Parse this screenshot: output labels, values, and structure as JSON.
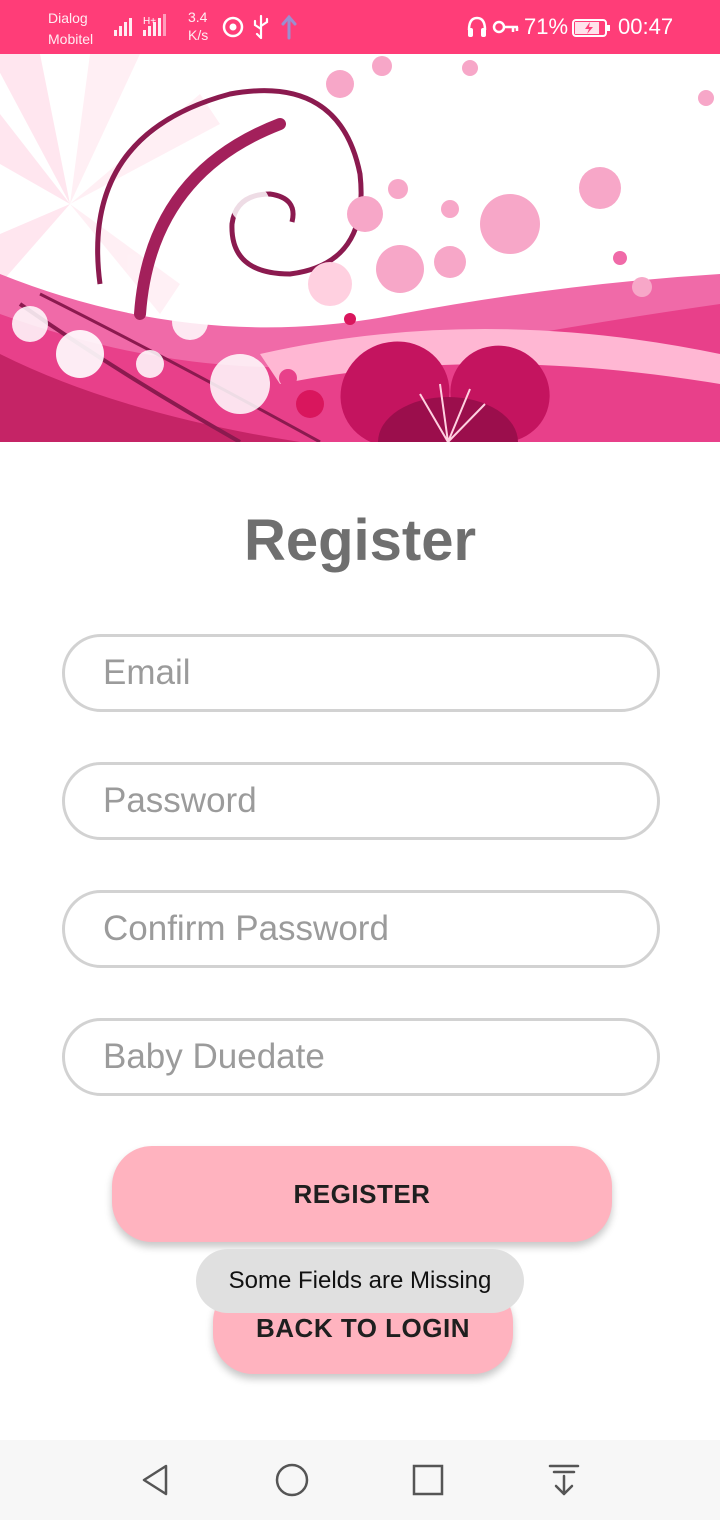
{
  "status_bar": {
    "carrier_line1": "Dialog",
    "carrier_line2": "Mobitel",
    "speed_value": "3.4",
    "speed_unit": "K/s",
    "battery_percent": "71%",
    "time": "00:47",
    "background_color": "#ff3d78",
    "icons": [
      "signal-icon",
      "signal-hplus-icon",
      "music-icon",
      "usb-icon",
      "upload-icon",
      "headphones-icon",
      "key-icon",
      "battery-charging-icon"
    ]
  },
  "hero": {
    "image_description_icon": "pink-swirl-flower-illustration"
  },
  "page": {
    "title": "Register"
  },
  "form": {
    "email_placeholder": "Email",
    "password_placeholder": "Password",
    "confirm_password_placeholder": "Confirm Password",
    "baby_duedate_placeholder": "Baby Duedate"
  },
  "buttons": {
    "register_label": "REGISTER",
    "back_to_login_label": "BACK TO LOGIN",
    "button_color": "#ffb3bf"
  },
  "toast": {
    "message": "Some Fields are Missing"
  },
  "nav_bar": {
    "icons": [
      "back-icon",
      "home-icon",
      "recents-icon",
      "notification-pull-icon"
    ]
  }
}
